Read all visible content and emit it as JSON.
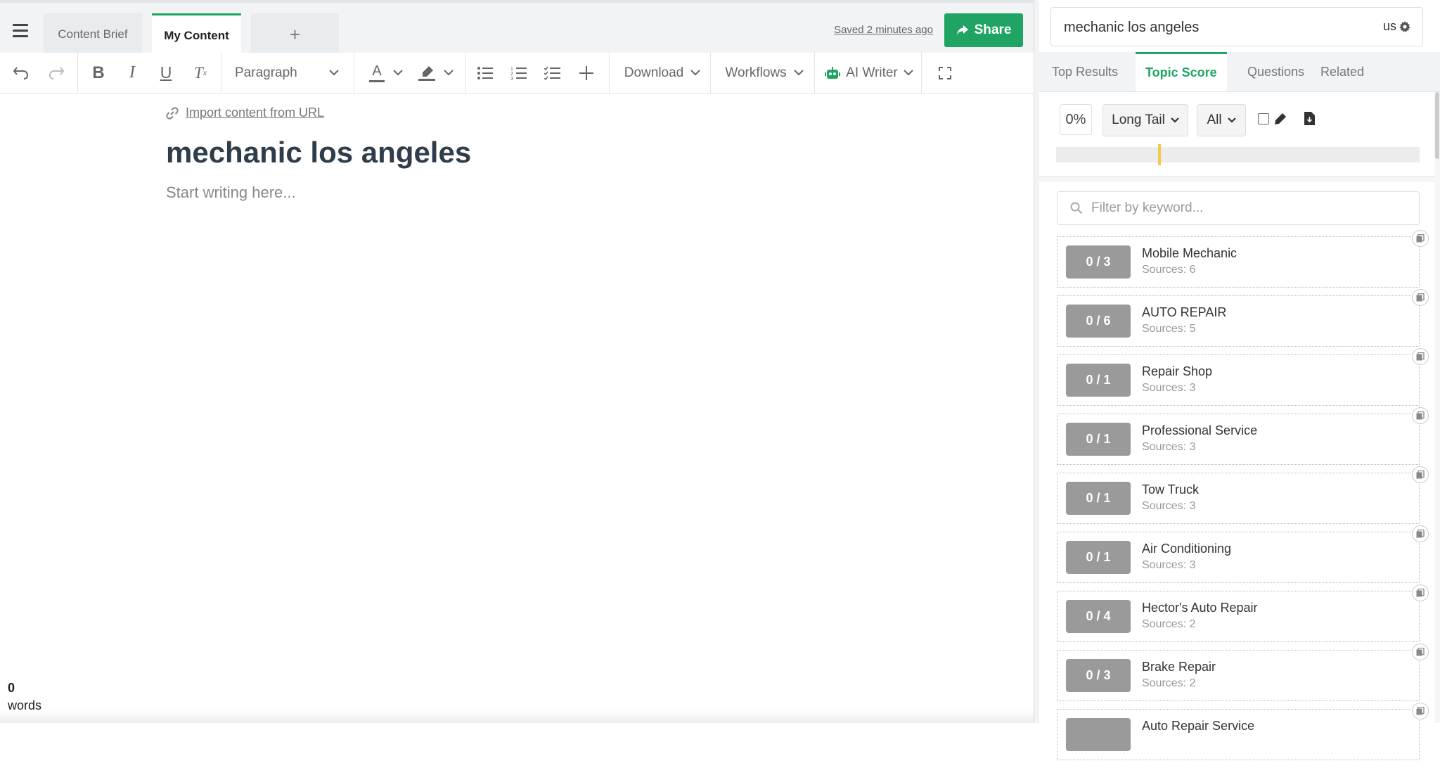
{
  "editor_tabs": {
    "content_brief": "Content Brief",
    "my_content": "My Content",
    "add": "+"
  },
  "status": {
    "saved_prefix": "Saved ",
    "saved_time": "2 minutes ago"
  },
  "share_label": "Share",
  "toolbar": {
    "paragraph": "Paragraph",
    "download": "Download",
    "workflows": "Workflows",
    "ai_writer": "AI Writer"
  },
  "editor": {
    "import_link": "Import content from URL",
    "title": "mechanic los angeles",
    "placeholder": "Start writing here..."
  },
  "word_count": {
    "value": "0",
    "label": "words"
  },
  "research": {
    "keyword": "mechanic los angeles",
    "locale": "us",
    "tabs": [
      "Top Results",
      "Topic Score",
      "Questions",
      "Related"
    ],
    "active_tab": "Topic Score",
    "score_percent": "0%",
    "score_fraction": 0,
    "marker_position_fraction": 0.28,
    "phrase_filter": "Long Tail",
    "scope_filter": "All",
    "filter_placeholder": "Filter by keyword...",
    "topics": [
      {
        "score": "0 / 3",
        "name": "Mobile Mechanic",
        "sources": "Sources: 6"
      },
      {
        "score": "0 / 6",
        "name": "AUTO REPAIR",
        "sources": "Sources: 5"
      },
      {
        "score": "0 / 1",
        "name": "Repair Shop",
        "sources": "Sources: 3"
      },
      {
        "score": "0 / 1",
        "name": "Professional Service",
        "sources": "Sources: 3"
      },
      {
        "score": "0 / 1",
        "name": "Tow Truck",
        "sources": "Sources: 3"
      },
      {
        "score": "0 / 1",
        "name": "Air Conditioning",
        "sources": "Sources: 3"
      },
      {
        "score": "0 / 4",
        "name": "Hector's Auto Repair",
        "sources": "Sources: 2"
      },
      {
        "score": "0 / 3",
        "name": "Brake Repair",
        "sources": "Sources: 2"
      },
      {
        "score": "",
        "name": "Auto Repair Service",
        "sources": ""
      }
    ]
  },
  "colors": {
    "accent": "#1fa463",
    "badge": "#9a9a9a",
    "marker": "#f7c948"
  },
  "icons": [
    "menu-icon",
    "undo-icon",
    "redo-icon",
    "bold-icon",
    "italic-icon",
    "underline-icon",
    "clear-format-icon",
    "chevron-down-icon",
    "text-color-icon",
    "highlight-icon",
    "bullet-list-icon",
    "numbered-list-icon",
    "checklist-icon",
    "plus-icon",
    "robot-icon",
    "fullscreen-icon",
    "link-icon",
    "share-icon",
    "gear-icon",
    "search-icon",
    "pen-icon",
    "file-download-icon",
    "copy-icon"
  ]
}
